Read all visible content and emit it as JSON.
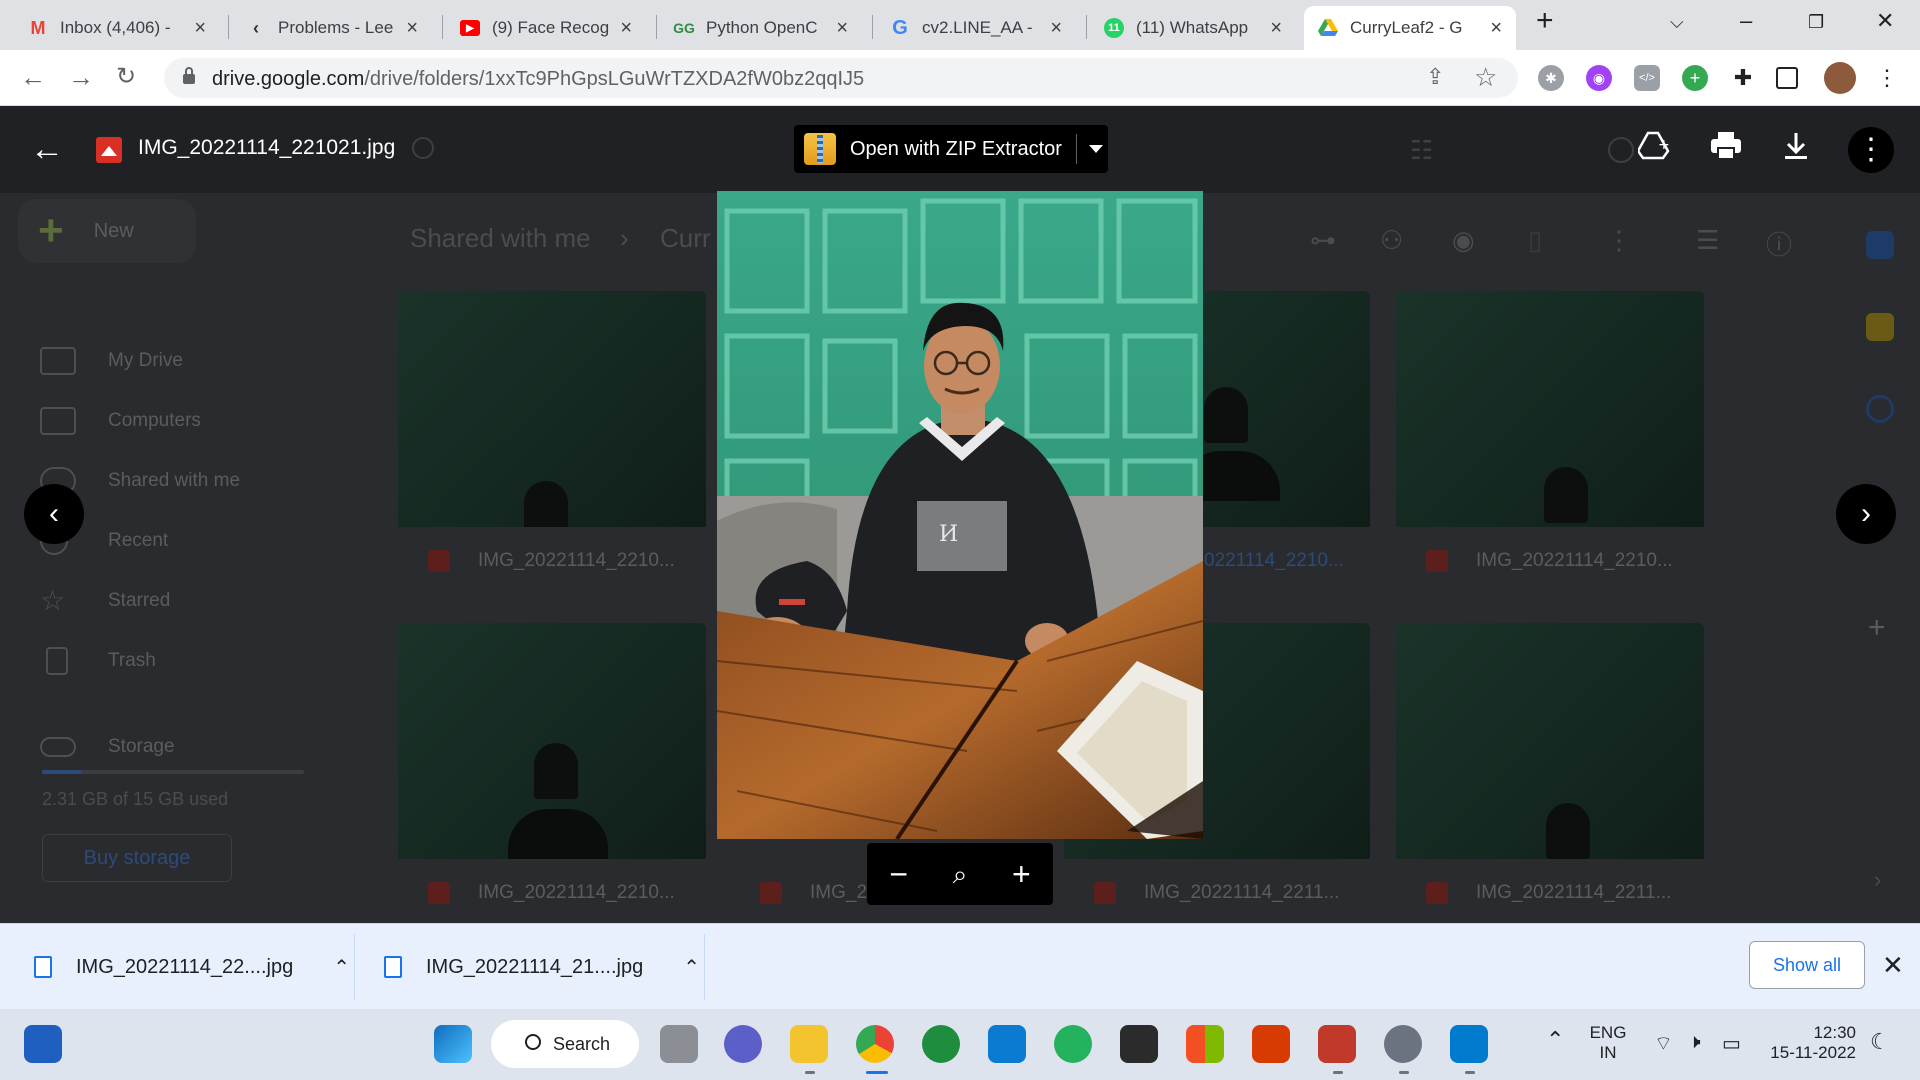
{
  "browser": {
    "tabs": [
      {
        "title": "Inbox (4,406) -",
        "icon": "gmail-icon",
        "color": "#ea4335"
      },
      {
        "title": "Problems - Lee",
        "icon": "leetcode-icon",
        "color": "#f89f1b"
      },
      {
        "title": "(9) Face Recog",
        "icon": "youtube-icon",
        "color": "#ff0000"
      },
      {
        "title": "Python OpenC",
        "icon": "geeksforgeeks-icon",
        "color": "#2f8d46"
      },
      {
        "title": "cv2.LINE_AA -",
        "icon": "google-icon",
        "color": "#4285f4"
      },
      {
        "title": "(11) WhatsApp",
        "icon": "whatsapp-icon",
        "color": "#25d366"
      },
      {
        "title": "CurryLeaf2 - G",
        "icon": "google-drive-icon",
        "color": "#34a853"
      }
    ],
    "url_host": "drive.google.com",
    "url_path": "/drive/folders/1xxTc9PhGpsLGuWrTZXDA2fW0bz2qqIJ5"
  },
  "drive": {
    "new_label": "New",
    "nav": [
      "My Drive",
      "Computers",
      "Shared with me",
      "Recent",
      "Starred",
      "Trash"
    ],
    "storage_label": "Storage",
    "storage_used": "2.31 GB of 15 GB used",
    "storage_fraction": 0.154,
    "buy_storage": "Buy storage",
    "breadcrumb": [
      "Shared with me",
      "Curr"
    ],
    "files": [
      "IMG_20221114_2210...",
      "0221114_2210...",
      "IMG_20221114_2210...",
      "IMG_20221114_2210...",
      "IMG_20221114_2211",
      "IMG_20221114_2211...",
      "IMG_20221114_2211..."
    ]
  },
  "viewer": {
    "file_title": "IMG_20221114_221021.jpg",
    "open_with": "Open with ZIP Extractor"
  },
  "downloads": {
    "items": [
      "IMG_20221114_22....jpg",
      "IMG_20221114_21....jpg"
    ],
    "show_all": "Show all"
  },
  "taskbar": {
    "search": "Search",
    "lang_top": "ENG",
    "lang_bottom": "IN",
    "time": "12:30",
    "date": "15-11-2022"
  }
}
